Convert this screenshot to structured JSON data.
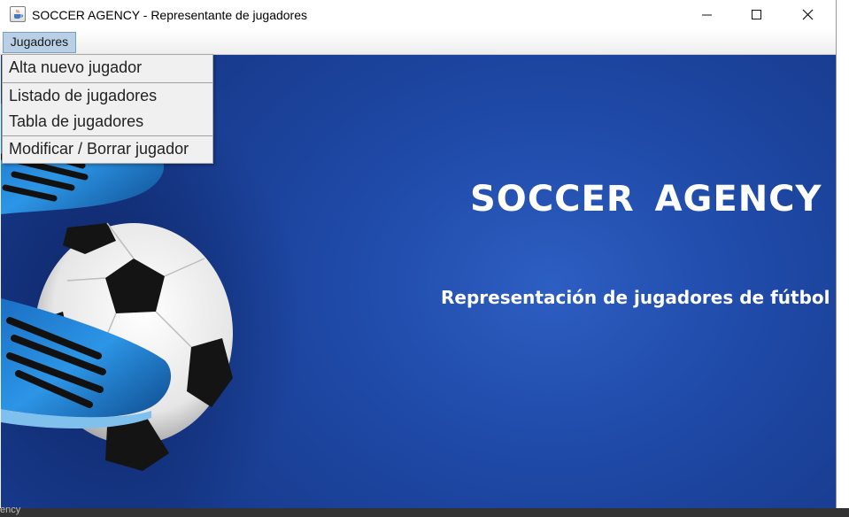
{
  "window": {
    "title": "SOCCER AGENCY - Representante de jugadores",
    "icon": "java-cup-icon",
    "controls": [
      "minimize-icon",
      "maximize-icon",
      "close-icon"
    ]
  },
  "menubar": {
    "menus": [
      {
        "label": "Jugadores"
      }
    ]
  },
  "dropdown": {
    "items": [
      {
        "label": "Alta nuevo jugador"
      },
      {
        "label": "Listado de jugadores"
      },
      {
        "label": "Tabla de jugadores"
      },
      {
        "label": "Modificar / Borrar jugador"
      }
    ]
  },
  "hero": {
    "title": "SOCCER  AGENCY",
    "subtitle": "Representación de jugadores de fútbol"
  },
  "taskbar": {
    "fragment": "ency"
  },
  "colors": {
    "background_blue": "#1f4aa8",
    "menu_highlight": "#b8cfe5",
    "boot_blue": "#1e7fd4"
  }
}
